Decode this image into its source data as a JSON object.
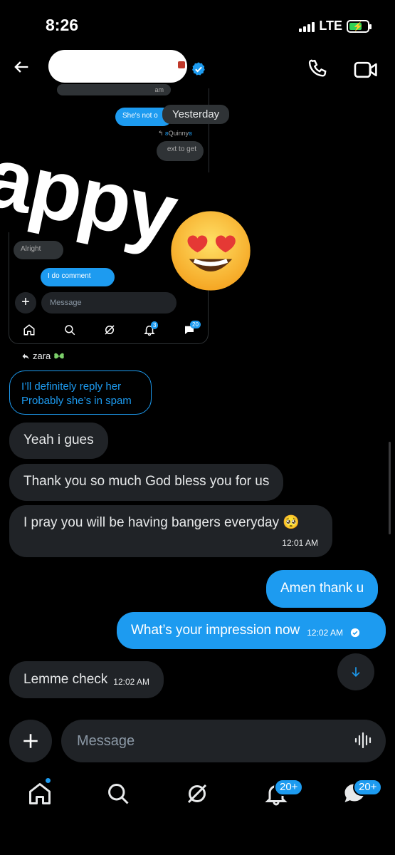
{
  "status_bar": {
    "time": "8:26",
    "network": "LTE"
  },
  "embedded": {
    "shot1_line1": "am",
    "shot1_sent": "She's not o",
    "shot1_divider": "Yesterday",
    "shot1_quote": "Quinny",
    "shot1_gray2": "ext to get",
    "shot2_gray": "Alright",
    "shot2_sent": "I do comment",
    "shot2_placeholder": "Message",
    "shot2_notif_badge": "3",
    "shot2_msg_badge": "20",
    "overlay_text": "appy",
    "overlay_emoji": "heart-eyes-emoji"
  },
  "reply": {
    "author": "zara",
    "quoted_line1": "I’ll definitely reply her",
    "quoted_line2": "Probably she’s in spam"
  },
  "messages": [
    {
      "dir": "in",
      "text": "Yeah i gues"
    },
    {
      "dir": "in",
      "text": "Thank you so much God bless you for us"
    },
    {
      "dir": "in",
      "text": "I pray you will be having bangers everyday 🥺",
      "time": "12:01 AM"
    },
    {
      "dir": "out",
      "text": "Amen thank u"
    },
    {
      "dir": "out",
      "text": "What’s your impression now",
      "time": "12:02 AM"
    },
    {
      "dir": "in",
      "text": "Lemme check",
      "time": "12:02 AM"
    }
  ],
  "composer": {
    "placeholder": "Message"
  },
  "nav": {
    "notifications_badge": "20+",
    "messages_badge": "20+"
  },
  "colors": {
    "accent": "#1d9bf0",
    "incoming_bubble": "#202327",
    "background": "#000000"
  }
}
